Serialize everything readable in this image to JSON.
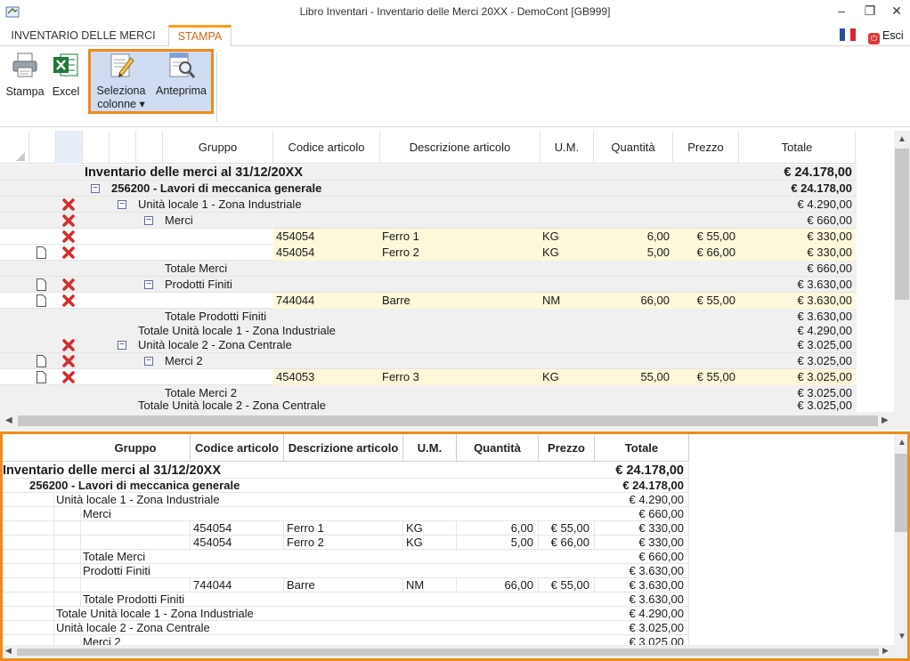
{
  "window": {
    "title": "Libro Inventari - Inventario delle Merci  20XX - DemoCont [GB999]",
    "minimize": "–",
    "restore": "❐",
    "close": "✕"
  },
  "tabs": [
    {
      "label": "INVENTARIO DELLE MERCI"
    },
    {
      "label": "STAMPA"
    }
  ],
  "esci_label": "Esci",
  "ribbon": {
    "stampa": "Stampa",
    "excel": "Excel",
    "seleziona_line1": "Seleziona",
    "seleziona_line2": "colonne ▾",
    "anteprima": "Anteprima"
  },
  "grid_headers": {
    "gruppo": "Gruppo",
    "codice": "Codice articolo",
    "descrizione": "Descrizione articolo",
    "um": "U.M.",
    "quantita": "Quantità",
    "prezzo": "Prezzo",
    "totale": "Totale"
  },
  "grid_rows": [
    {
      "label": "Inventario delle merci al 31/12/20XX",
      "totale": "€ 24.178,00"
    },
    {
      "label": "256200 - Lavori di meccanica generale",
      "totale": "€ 24.178,00"
    },
    {
      "label": "Unità locale 1 - Zona Industriale",
      "totale": "€ 4.290,00"
    },
    {
      "label": "Merci",
      "totale": "€ 660,00"
    },
    {
      "codice": "454054",
      "descrizione": "Ferro 1",
      "um": "KG",
      "quantita": "6,00",
      "prezzo": "€ 55,00",
      "totale": "€ 330,00"
    },
    {
      "codice": "454054",
      "descrizione": "Ferro 2",
      "um": "KG",
      "quantita": "5,00",
      "prezzo": "€ 66,00",
      "totale": "€ 330,00"
    },
    {
      "label": "Totale Merci",
      "totale": "€ 660,00"
    },
    {
      "label": "Prodotti Finiti",
      "totale": "€ 3.630,00"
    },
    {
      "codice": "744044",
      "descrizione": "Barre",
      "um": "NM",
      "quantita": "66,00",
      "prezzo": "€ 55,00",
      "totale": "€ 3.630,00"
    },
    {
      "label": "Totale Prodotti Finiti",
      "totale": "€ 3.630,00"
    },
    {
      "label": "Totale Unità locale 1 - Zona Industriale",
      "totale": "€ 4.290,00"
    },
    {
      "label": "Unità locale 2 - Zona Centrale",
      "totale": "€ 3.025,00"
    },
    {
      "label": "Merci 2",
      "totale": "€ 3.025,00"
    },
    {
      "codice": "454053",
      "descrizione": "Ferro 3",
      "um": "KG",
      "quantita": "55,00",
      "prezzo": "€ 55,00",
      "totale": "€ 3.025,00"
    },
    {
      "label": "Totale Merci 2",
      "totale": "€ 3.025,00"
    },
    {
      "label": "Totale Unità locale 2 - Zona Centrale",
      "totale": "€ 3.025,00"
    }
  ],
  "preview_headers": {
    "gruppo": "Gruppo",
    "codice": "Codice articolo",
    "descrizione": "Descrizione articolo",
    "um": "U.M.",
    "quantita": "Quantità",
    "prezzo": "Prezzo",
    "totale": "Totale"
  },
  "preview_rows": [
    {
      "label": "Inventario delle merci al 31/12/20XX",
      "totale": "€ 24.178,00"
    },
    {
      "label": "256200 - Lavori di meccanica generale",
      "totale": "€ 24.178,00"
    },
    {
      "label": "Unità locale 1 - Zona Industriale",
      "totale": "€ 4.290,00"
    },
    {
      "label": "Merci",
      "totale": "€ 660,00"
    },
    {
      "codice": "454054",
      "descrizione": "Ferro 1",
      "um": "KG",
      "quantita": "6,00",
      "prezzo": "€ 55,00",
      "totale": "€ 330,00"
    },
    {
      "codice": "454054",
      "descrizione": "Ferro 2",
      "um": "KG",
      "quantita": "5,00",
      "prezzo": "€ 66,00",
      "totale": "€ 330,00"
    },
    {
      "label": "Totale Merci",
      "totale": "€ 660,00"
    },
    {
      "label": "Prodotti Finiti",
      "totale": "€ 3.630,00"
    },
    {
      "codice": "744044",
      "descrizione": "Barre",
      "um": "NM",
      "quantita": "66,00",
      "prezzo": "€ 55,00",
      "totale": "€ 3.630,00"
    },
    {
      "label": "Totale Prodotti Finiti",
      "totale": "€ 3.630,00"
    },
    {
      "label": "Totale Unità locale 1 - Zona Industriale",
      "totale": "€ 4.290,00"
    },
    {
      "label": "Unità locale 2 - Zona Centrale",
      "totale": "€ 3.025,00"
    },
    {
      "label": "Merci 2",
      "totale": "€ 3.025,00"
    }
  ],
  "colors": {
    "accent_orange": "#f08a1c",
    "tab_text": "#d2691e",
    "selected_group_bg": "#cfdcf2",
    "item_row_bg": "#fdf8d9"
  }
}
